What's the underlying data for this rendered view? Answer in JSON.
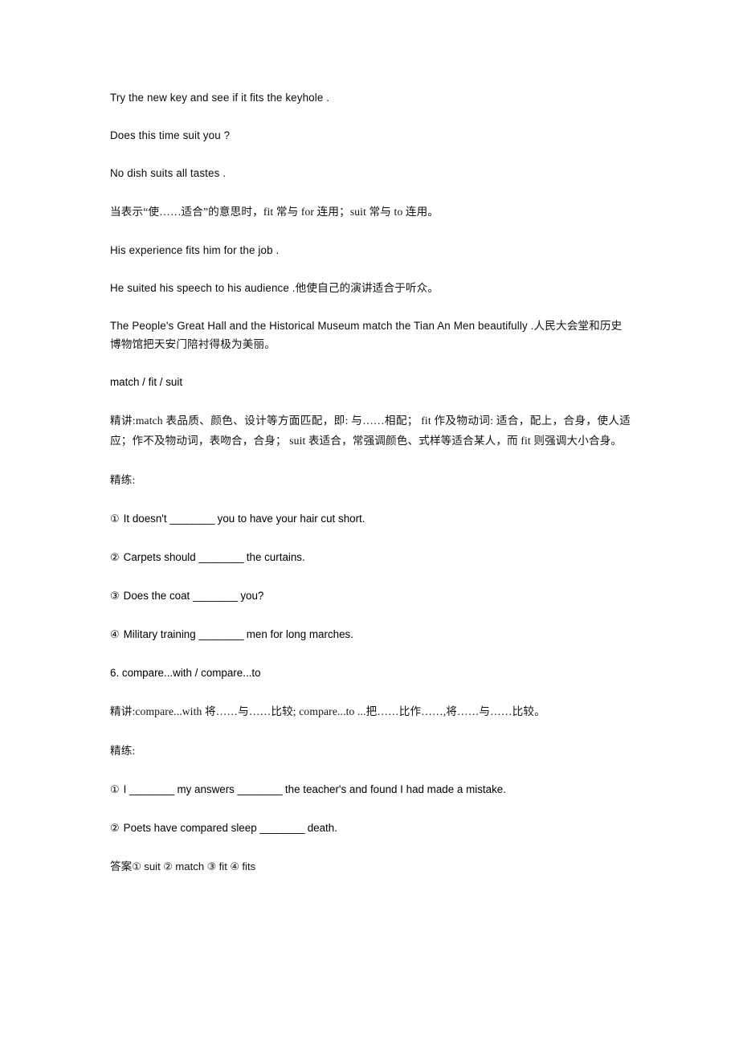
{
  "page": {
    "background": "#ffffff",
    "text_color": "#0b0b0b",
    "cjk_text_color": "#131313"
  },
  "blocks": {
    "example_1": "Try the new key and see if it fits the keyhole .",
    "example_2": "Does this time suit you ?",
    "example_3": "No dish suits all tastes .",
    "note_fit_suit": "当表示“使……适合”的意思时，fit 常与 for 连用；suit 常与 to 连用。",
    "example_4": "His experience fits him for the job .",
    "example_5_en": "He suited his speech to his audience .",
    "example_5_cn": "他使自己的演讲适合于听众。",
    "example_6_en": "The People's Great Hall and the Historical Museum match the Tian An Men beautifully .",
    "example_6_cn": "人民大会堂和历史博物馆把天安门陪衬得极为美丽。",
    "heading_match_fit_suit": "match / fit / suit",
    "explain_label": "精讲:",
    "explain_text": "match 表品质、颜色、设计等方面匹配，即: 与……相配； fit 作及物动词: 适合，配上，合身，使人适应；作不及物动词，表吻合，合身； suit 表适合，常强调颜色、式样等适合某人，而 fit 则强调大小合身。",
    "practice_label_1": "精练:",
    "heading_compare": "6. compare...with / compare...to",
    "explain_label_2": "精讲:",
    "explain_compare": "compare...with 将……与……比较; compare...to ...把……比作……,将……与……比较。",
    "practice_label_2": "精练:",
    "answers_label": "答案"
  },
  "exercises_set_1": [
    {
      "marker": "①",
      "before": "It doesn't",
      "blank": "________",
      "after": "you to have your hair cut short."
    },
    {
      "marker": "②",
      "before": "Carpets should",
      "blank": "________",
      "after": "the curtains."
    },
    {
      "marker": "③",
      "before": "Does the coat",
      "blank": "________",
      "after": "you?"
    },
    {
      "marker": "④",
      "before": "Military training",
      "blank": "________",
      "after": "men for long marches."
    }
  ],
  "exercises_set_2": [
    {
      "marker": "①",
      "before": "I",
      "blank": "________",
      "middle": "my answers",
      "blank2": "________",
      "after": "the teacher's and found I had made a mistake."
    },
    {
      "marker": "②",
      "before": "Poets have compared sleep",
      "blank": "________",
      "after": "death."
    }
  ],
  "answers": [
    {
      "marker": "①",
      "value": "suit"
    },
    {
      "marker": "②",
      "value": "match"
    },
    {
      "marker": "③",
      "value": "fit"
    },
    {
      "marker": "④",
      "value": "fits"
    }
  ]
}
